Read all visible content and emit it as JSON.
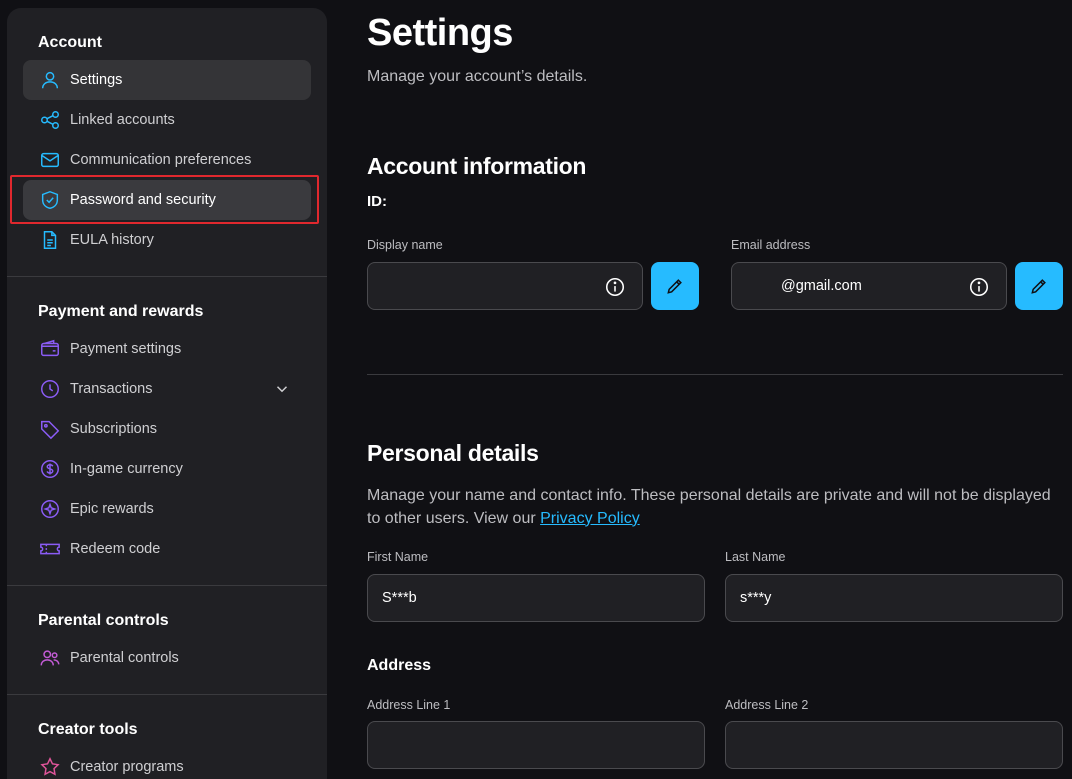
{
  "sidebar": {
    "sections": [
      {
        "title": "Account",
        "items": [
          {
            "label": "Settings"
          },
          {
            "label": "Linked accounts"
          },
          {
            "label": "Communication preferences"
          },
          {
            "label": "Password and security"
          },
          {
            "label": "EULA history"
          }
        ]
      },
      {
        "title": "Payment and rewards",
        "items": [
          {
            "label": "Payment settings"
          },
          {
            "label": "Transactions"
          },
          {
            "label": "Subscriptions"
          },
          {
            "label": "In-game currency"
          },
          {
            "label": "Epic rewards"
          },
          {
            "label": "Redeem code"
          }
        ]
      },
      {
        "title": "Parental controls",
        "items": [
          {
            "label": "Parental controls"
          }
        ]
      },
      {
        "title": "Creator tools",
        "items": [
          {
            "label": "Creator programs"
          }
        ]
      }
    ]
  },
  "main": {
    "title": "Settings",
    "subtitle": "Manage your account’s details.",
    "account_info": {
      "heading": "Account information",
      "id_label": "ID:",
      "display_name": {
        "label": "Display name",
        "value": ""
      },
      "email": {
        "label": "Email address",
        "value": "@gmail.com"
      }
    },
    "personal": {
      "heading": "Personal details",
      "description": "Manage your name and contact info. These personal details are private and will not be displayed to other users. View our ",
      "privacy_link": "Privacy Policy",
      "first_name": {
        "label": "First Name",
        "value": "S***b"
      },
      "last_name": {
        "label": "Last Name",
        "value": "s***y"
      }
    },
    "address": {
      "heading": "Address",
      "line1": {
        "label": "Address Line 1",
        "value": ""
      },
      "line2": {
        "label": "Address Line 2",
        "value": ""
      }
    }
  },
  "colors": {
    "accent": "#26bbff",
    "highlight": "#e0282e",
    "background": "#101014",
    "sidebar": "#202024"
  },
  "icons": {
    "settings": "user-icon",
    "linked": "share-nodes-icon",
    "communication": "envelope-icon",
    "security": "shield-check-icon",
    "eula": "document-icon",
    "payment": "wallet-icon",
    "transactions": "clock-icon",
    "subscriptions": "tag-icon",
    "currency": "dollar-coin-icon",
    "rewards": "sparkle-coin-icon",
    "redeem": "ticket-icon",
    "parental": "users-icon",
    "creator": "star-icon"
  }
}
